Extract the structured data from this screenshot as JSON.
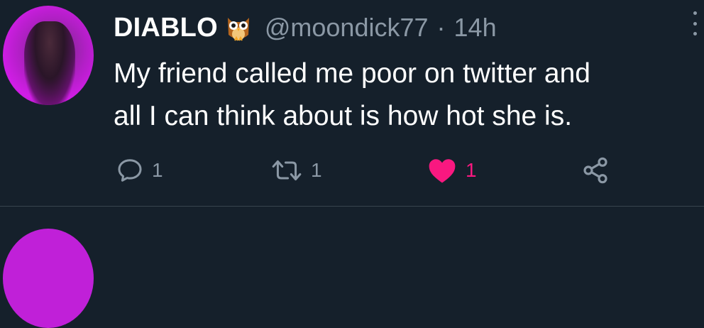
{
  "tweet": {
    "author": {
      "display_name": "DIABLO",
      "emoji_icon": "owl-emoji-icon",
      "handle": "@moondick77",
      "separator": "·",
      "time": "14h"
    },
    "text_lines": [
      "My friend called me poor on twitter and",
      "all I can think about is how hot she is."
    ],
    "actions": {
      "reply_count": "1",
      "retweet_count": "1",
      "like_count": "1"
    },
    "colors": {
      "background": "#15202b",
      "secondary_text": "#8b98a5",
      "like_pink": "#f91880",
      "avatar_purple": "#c020d8"
    }
  }
}
